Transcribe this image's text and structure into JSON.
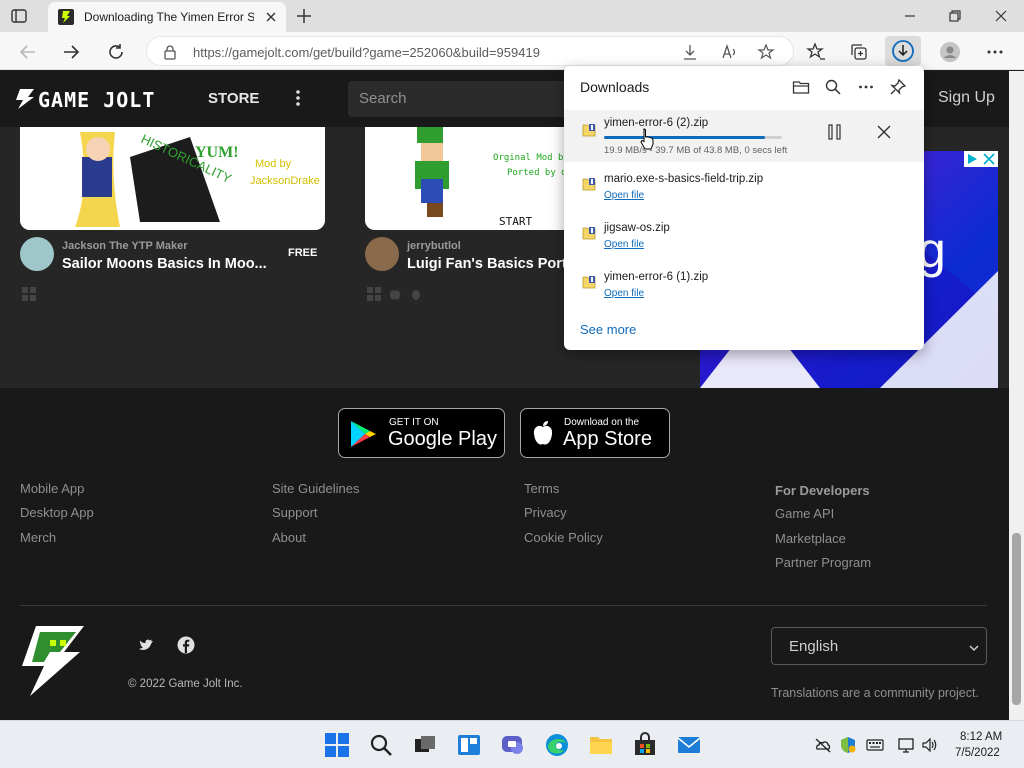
{
  "browser": {
    "tab_title": "Downloading The Yimen Error Se",
    "url": "https://gamejolt.com/get/build?game=252060&build=959419"
  },
  "site": {
    "logo_text": "GAME JOLT",
    "nav_store": "STORE",
    "search_placeholder": "Search",
    "sign_up": "Sign Up"
  },
  "games": [
    {
      "author": "Jackson The YTP Maker",
      "title": "Sailor Moons Basics In Moo...",
      "price": "FREE",
      "thumb_text": "YUM!  Mod by JacksonDrake"
    },
    {
      "author": "jerrybutlol",
      "title": "Luigi Fan's Basics Port",
      "price": "",
      "thumb_text": "START"
    }
  ],
  "ad": {
    "letter": "g"
  },
  "footer": {
    "google_play": {
      "small": "GET IT ON",
      "big": "Google Play"
    },
    "app_store": {
      "small": "Download on the",
      "big": "App Store"
    },
    "col1": [
      "Mobile App",
      "Desktop App",
      "Merch"
    ],
    "col2": [
      "Site Guidelines",
      "Support",
      "About"
    ],
    "col3": [
      "Terms",
      "Privacy",
      "Cookie Policy"
    ],
    "col4_heading": "For Developers",
    "col4": [
      "Game API",
      "Marketplace",
      "Partner Program"
    ],
    "copyright": "© 2022 Game Jolt Inc.",
    "language": "English",
    "translations_note": "Translations are a community project."
  },
  "downloads": {
    "title": "Downloads",
    "items": [
      {
        "name": "yimen-error-6 (2).zip",
        "status": "19.9 MB/s - 39.7 MB of 43.8 MB, 0 secs left",
        "progress": 0.906
      },
      {
        "name": "mario.exe-s-basics-field-trip.zip",
        "action": "Open file"
      },
      {
        "name": "jigsaw-os.zip",
        "action": "Open file"
      },
      {
        "name": "yimen-error-6 (1).zip",
        "action": "Open file"
      }
    ],
    "see_more": "See more"
  },
  "taskbar": {
    "time": "8:12 AM",
    "date": "7/5/2022"
  },
  "colors": {
    "accent_blue": "#0f6cbd",
    "page_bg": "#262626",
    "footer_bg": "#191919",
    "ad_blue": "#2a1f9e"
  }
}
